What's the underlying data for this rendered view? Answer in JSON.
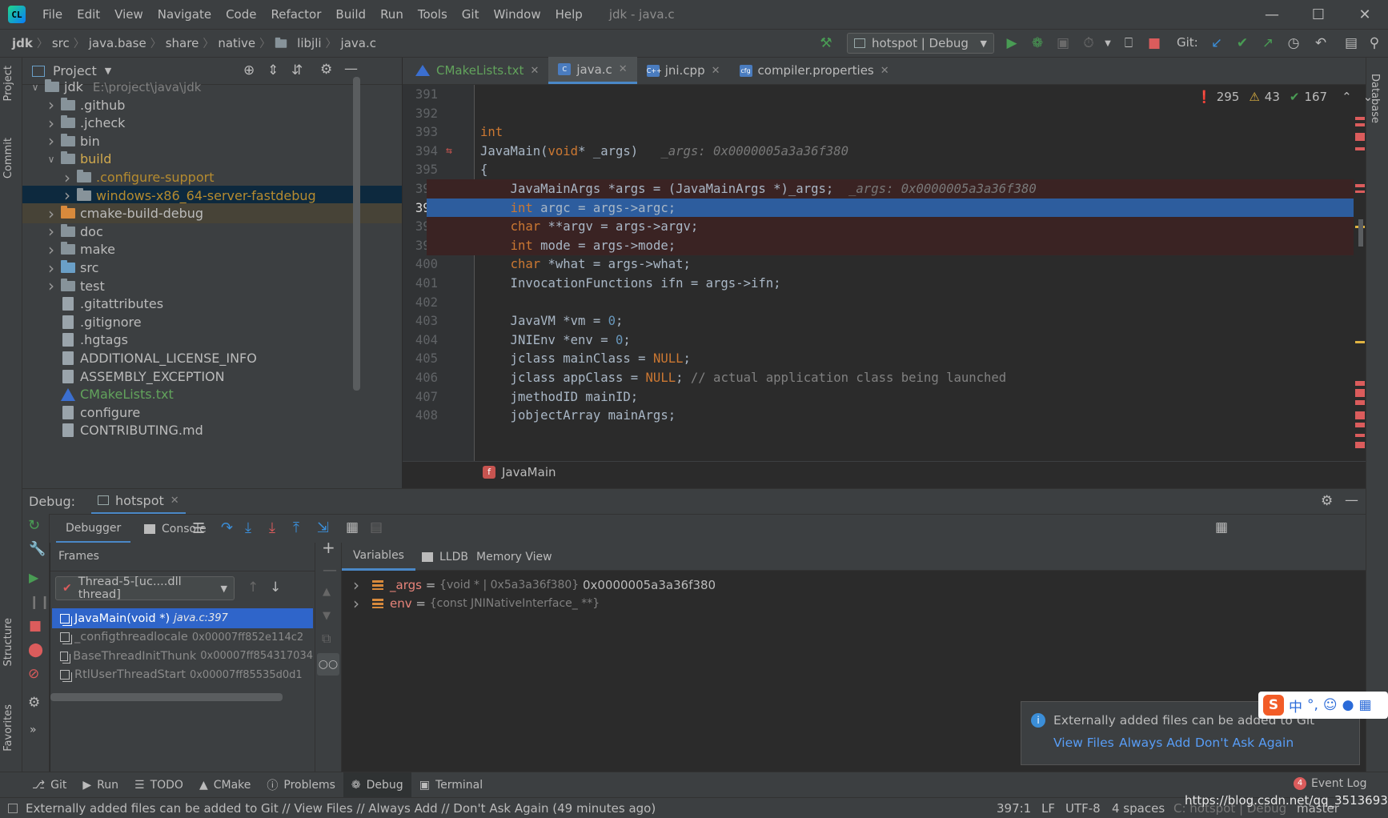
{
  "menu": [
    "File",
    "Edit",
    "View",
    "Navigate",
    "Code",
    "Refactor",
    "Build",
    "Run",
    "Tools",
    "Git",
    "Window",
    "Help"
  ],
  "window_title": "jdk - java.c",
  "breadcrumbs": [
    "jdk",
    "src",
    "java.base",
    "share",
    "native",
    "libjli",
    "java.c"
  ],
  "run_config": "hotspot | Debug",
  "git_label": "Git:",
  "project_panel": {
    "title": "Project",
    "rows": [
      {
        "name": "jdk",
        "extra": "E:\\project\\java\\jdk",
        "depth": 0,
        "arrow": "open",
        "kind": "folder",
        "color": "#bbbbbb"
      },
      {
        "name": ".github",
        "depth": 1,
        "arrow": "closed",
        "kind": "folder",
        "color": "#bbbbbb"
      },
      {
        "name": ".jcheck",
        "depth": 1,
        "arrow": "closed",
        "kind": "folder",
        "color": "#bbbbbb"
      },
      {
        "name": "bin",
        "depth": 1,
        "arrow": "closed",
        "kind": "folder",
        "color": "#bbbbbb"
      },
      {
        "name": "build",
        "depth": 1,
        "arrow": "open",
        "kind": "folder",
        "color": "#d0a94e"
      },
      {
        "name": ".configure-support",
        "depth": 2,
        "arrow": "closed",
        "kind": "folder",
        "color": "#b58b2f"
      },
      {
        "name": "windows-x86_64-server-fastdebug",
        "depth": 2,
        "arrow": "closed",
        "kind": "folder",
        "color": "#b58b2f",
        "state": "selected"
      },
      {
        "name": "cmake-build-debug",
        "depth": 1,
        "arrow": "closed",
        "kind": "folder-orange",
        "color": "#bbbbbb",
        "state": "highlight"
      },
      {
        "name": "doc",
        "depth": 1,
        "arrow": "closed",
        "kind": "folder",
        "color": "#bbbbbb"
      },
      {
        "name": "make",
        "depth": 1,
        "arrow": "closed",
        "kind": "folder",
        "color": "#bbbbbb"
      },
      {
        "name": "src",
        "depth": 1,
        "arrow": "closed",
        "kind": "folder-blue",
        "color": "#bbbbbb"
      },
      {
        "name": "test",
        "depth": 1,
        "arrow": "closed",
        "kind": "folder",
        "color": "#bbbbbb"
      },
      {
        "name": ".gitattributes",
        "depth": 1,
        "arrow": "none",
        "kind": "file",
        "color": "#bbbbbb"
      },
      {
        "name": ".gitignore",
        "depth": 1,
        "arrow": "none",
        "kind": "file",
        "color": "#bbbbbb"
      },
      {
        "name": ".hgtags",
        "depth": 1,
        "arrow": "none",
        "kind": "file",
        "color": "#bbbbbb"
      },
      {
        "name": "ADDITIONAL_LICENSE_INFO",
        "depth": 1,
        "arrow": "none",
        "kind": "file",
        "color": "#bbbbbb"
      },
      {
        "name": "ASSEMBLY_EXCEPTION",
        "depth": 1,
        "arrow": "none",
        "kind": "file",
        "color": "#bbbbbb"
      },
      {
        "name": "CMakeLists.txt",
        "depth": 1,
        "arrow": "none",
        "kind": "cmake",
        "color": "#62a35c"
      },
      {
        "name": "configure",
        "depth": 1,
        "arrow": "none",
        "kind": "file",
        "color": "#bbbbbb"
      },
      {
        "name": "CONTRIBUTING.md",
        "depth": 1,
        "arrow": "none",
        "kind": "file",
        "color": "#bbbbbb"
      }
    ]
  },
  "editor_tabs": [
    {
      "label": "CMakeLists.txt",
      "icon": "cmake",
      "color": "#62a35c",
      "active": false
    },
    {
      "label": "java.c",
      "icon": "c",
      "color": "#bbbbbb",
      "active": true
    },
    {
      "label": "jni.cpp",
      "icon": "cpp",
      "color": "#bbbbbb",
      "active": false
    },
    {
      "label": "compiler.properties",
      "icon": "properties",
      "color": "#bbbbbb",
      "active": false
    }
  ],
  "inspections": {
    "errors": "295",
    "warnings": "43",
    "weak": "167"
  },
  "code_lines": [
    {
      "n": "391",
      "html": ""
    },
    {
      "n": "392",
      "html": ""
    },
    {
      "n": "393",
      "html": "<span class='kw'>int</span>"
    },
    {
      "n": "394",
      "html": "JavaMain(<span class='kw'>void</span>* _args)   <span class='hint'>_args: 0x0000005a3a36f380</span>",
      "marker": "override"
    },
    {
      "n": "395",
      "html": "{"
    },
    {
      "n": "396",
      "html": "    JavaMainArgs *args = (JavaMainArgs *)_args;  <span class='hint'>_args: 0x0000005a3a36f380</span>",
      "marker": "bp"
    },
    {
      "n": "397",
      "html": "    <span class='kw'>int</span> argc = args->argc;",
      "marker": "exec"
    },
    {
      "n": "398",
      "html": "    <span class='kw'>char</span> **argv = args->argv;",
      "marker": "bp"
    },
    {
      "n": "399",
      "html": "    <span class='kw'>int</span> mode = args->mode;",
      "marker": "bp"
    },
    {
      "n": "400",
      "html": "    <span class='kw'>char</span> *what = args->what;"
    },
    {
      "n": "401",
      "html": "    InvocationFunctions ifn = args->ifn;"
    },
    {
      "n": "402",
      "html": ""
    },
    {
      "n": "403",
      "html": "    JavaVM *vm = <span class='num'>0</span>;"
    },
    {
      "n": "404",
      "html": "    JNIEnv *env = <span class='num'>0</span>;"
    },
    {
      "n": "405",
      "html": "    jclass mainClass = <span class='kw'>NULL</span>;"
    },
    {
      "n": "406",
      "html": "    jclass appClass = <span class='kw'>NULL</span>; <span class='cm'>// actual application class being launched</span>"
    },
    {
      "n": "407",
      "html": "    jmethodID mainID;"
    },
    {
      "n": "408",
      "html": "    jobjectArray mainArgs;"
    }
  ],
  "function_breadcrumb": "JavaMain",
  "debug": {
    "label": "Debug:",
    "session_tab": "hotspot",
    "tabs": [
      "Debugger",
      "Console"
    ],
    "frames_title": "Frames",
    "thread_select": "Thread-5-[uc....dll thread]",
    "frames": [
      {
        "func": "JavaMain(void *)",
        "loc": "java.c:397",
        "selected": true
      },
      {
        "func": "_configthreadlocale",
        "loc": "0x00007ff852e114c2",
        "selected": false
      },
      {
        "func": "BaseThreadInitThunk",
        "loc": "0x00007ff854317034",
        "selected": false
      },
      {
        "func": "RtlUserThreadStart",
        "loc": "0x00007ff85535d0d1",
        "selected": false
      }
    ],
    "var_tabs": [
      "Variables",
      "LLDB",
      "Memory View"
    ],
    "variables": [
      {
        "name": "_args",
        "eq": " = ",
        "type": "{void * | 0x5a3a36f380}",
        "value": " 0x0000005a3a36f380"
      },
      {
        "name": "env",
        "eq": " = ",
        "type": "{const JNINativeInterface_ **}",
        "value": ""
      }
    ]
  },
  "notification": {
    "text": "Externally added files can be added to Git",
    "actions": [
      "View Files",
      "Always Add",
      "Don't Ask Again"
    ]
  },
  "side_tabs": {
    "left": [
      "Project",
      "Commit",
      "Structure",
      "Favorites"
    ],
    "right": [
      "Database"
    ]
  },
  "tool_tabs": [
    "Git",
    "Run",
    "TODO",
    "CMake",
    "Problems",
    "Debug",
    "Terminal"
  ],
  "event_log": {
    "count": "4",
    "label": "Event Log"
  },
  "status": {
    "message": "Externally added files can be added to Git // View Files // Always Add // Don't Ask Again (49 minutes ago)",
    "position": "397:1",
    "line_sep": "LF",
    "encoding": "UTF-8",
    "indent": "4 spaces",
    "context": "C: hotspot | Debug",
    "branch": "master",
    "watermark": "https://blog.csdn.net/qq_35136937"
  },
  "colors": {
    "accent": "#4a88c7",
    "breakpoint": "#db5c5c",
    "exec_line": "#2d5d9e",
    "run_green": "#499c54"
  }
}
